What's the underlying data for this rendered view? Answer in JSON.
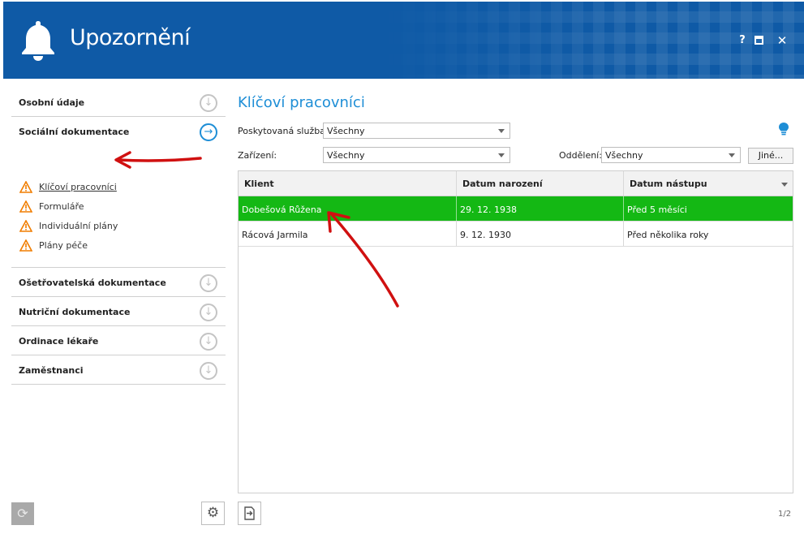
{
  "app": {
    "title": "Upozornění",
    "icon": "bell-icon",
    "controls": {
      "help": "?",
      "maximize": "maximize-icon",
      "close": "✕"
    }
  },
  "sidebar": {
    "sections": [
      {
        "label": "Osobní údaje",
        "icon": "chevron-down-circle-icon"
      },
      {
        "label": "Sociální dokumentace",
        "icon": "chevron-right-circle-icon",
        "expanded": true,
        "items": [
          {
            "label": "Klíčoví pracovníci",
            "icon": "warning-icon"
          },
          {
            "label": "Formuláře",
            "icon": "warning-icon"
          },
          {
            "label": "Individuální plány",
            "icon": "warning-icon"
          },
          {
            "label": "Plány péče",
            "icon": "warning-icon"
          }
        ]
      },
      {
        "label": "Ošetřovatelská dokumentace",
        "icon": "chevron-down-circle-icon"
      },
      {
        "label": "Nutriční dokumentace",
        "icon": "chevron-down-circle-icon"
      },
      {
        "label": "Ordinace lékaře",
        "icon": "chevron-down-circle-icon"
      },
      {
        "label": "Zaměstnanci",
        "icon": "chevron-down-circle-icon"
      }
    ]
  },
  "main": {
    "title": "Klíčoví pracovníci",
    "filters": {
      "service": {
        "label": "Poskytovaná služba:",
        "value": "Všechny"
      },
      "facility": {
        "label": "Zařízení:",
        "value": "Všechny"
      },
      "department": {
        "label": "Oddělení:",
        "value": "Všechny"
      },
      "more_button": "Jiné..."
    },
    "table": {
      "columns": [
        "Klient",
        "Datum narození",
        "Datum nástupu"
      ],
      "rows": [
        {
          "client": "Dobešová Růžena",
          "birth": "29. 12. 1938",
          "entry": "Před 5 měsíci",
          "selected": true
        },
        {
          "client": "Rácová Jarmila",
          "birth": "9. 12. 1930",
          "entry": "Před několika roky",
          "selected": false
        }
      ]
    },
    "pager": "1/2"
  },
  "colors": {
    "header": "#0f5aa6",
    "accent": "#1e8ed6",
    "selected_row": "#14b814",
    "warning": "#f07d00",
    "annotation": "#d01010"
  }
}
